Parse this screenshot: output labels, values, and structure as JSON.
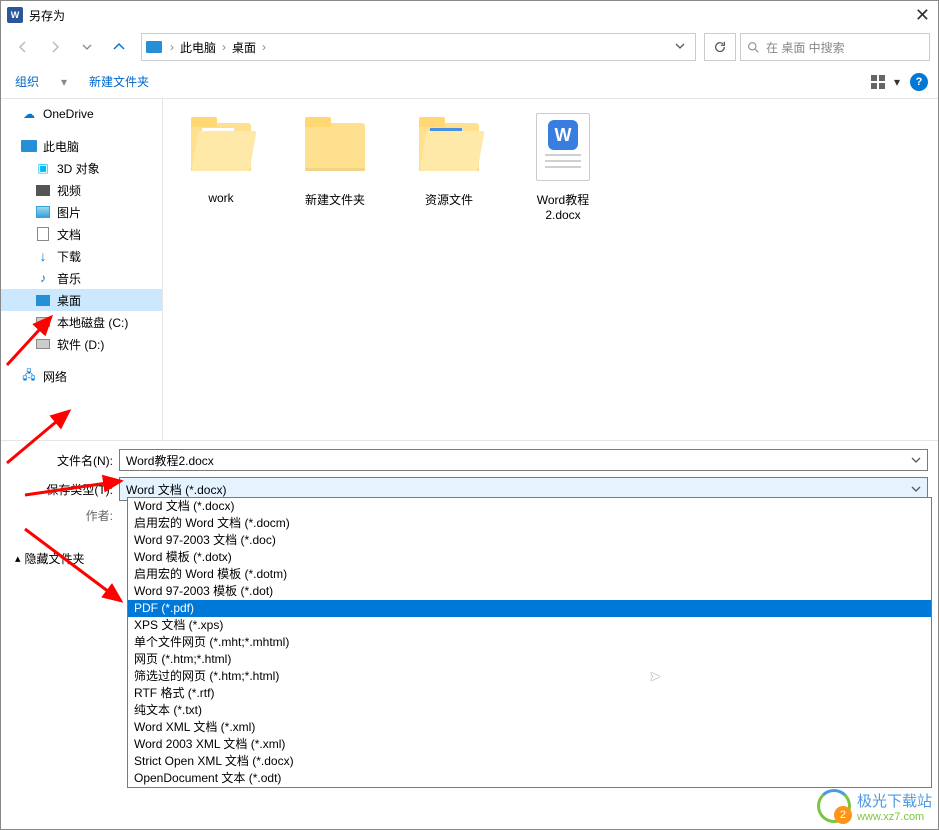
{
  "title": "另存为",
  "breadcrumb": {
    "pc": "此电脑",
    "desktop": "桌面"
  },
  "search_placeholder": "在 桌面 中搜索",
  "toolbar": {
    "organize": "组织",
    "newfolder": "新建文件夹"
  },
  "tree": {
    "onedrive": "OneDrive",
    "thispc": "此电脑",
    "obj3d": "3D 对象",
    "video": "视频",
    "pictures": "图片",
    "documents": "文档",
    "downloads": "下载",
    "music": "音乐",
    "desktop": "桌面",
    "cdisk": "本地磁盘 (C:)",
    "ddisk": "软件 (D:)",
    "network": "网络"
  },
  "files": {
    "f0": "work",
    "f1": "新建文件夹",
    "f2": "资源文件",
    "f3": "Word教程2.docx"
  },
  "form": {
    "filename_label": "文件名(N):",
    "filename_value": "Word教程2.docx",
    "savetype_label": "保存类型(T):",
    "savetype_value": "Word 文档 (*.docx)",
    "author_label": "作者:"
  },
  "filetypes": [
    "Word 文档 (*.docx)",
    "启用宏的 Word 文档 (*.docm)",
    "Word 97-2003 文档 (*.doc)",
    "Word 模板 (*.dotx)",
    "启用宏的 Word 模板 (*.dotm)",
    "Word 97-2003 模板 (*.dot)",
    "PDF (*.pdf)",
    "XPS 文档 (*.xps)",
    "单个文件网页 (*.mht;*.mhtml)",
    "网页 (*.htm;*.html)",
    "筛选过的网页 (*.htm;*.html)",
    "RTF 格式 (*.rtf)",
    "纯文本 (*.txt)",
    "Word XML 文档 (*.xml)",
    "Word 2003 XML 文档 (*.xml)",
    "Strict Open XML 文档 (*.docx)",
    "OpenDocument 文本 (*.odt)"
  ],
  "hide_folders": "隐藏文件夹",
  "watermark": {
    "name": "极光下载站",
    "url": "www.xz7.com"
  }
}
